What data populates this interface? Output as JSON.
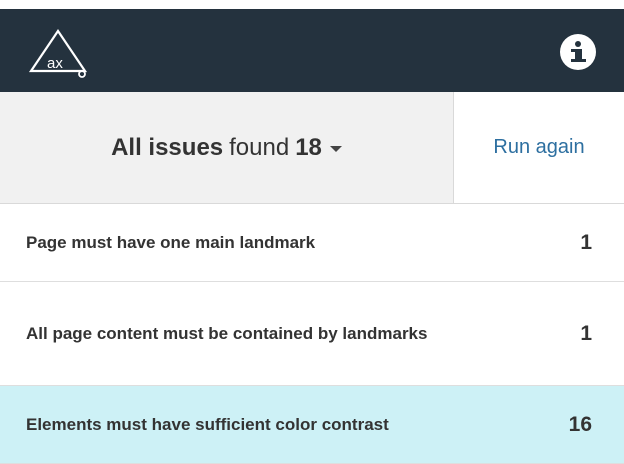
{
  "app": {
    "logo_text": "ax",
    "colors": {
      "header_bg": "#24323e",
      "toolbar_bg": "#f1f1f1",
      "link": "#2d6fa0",
      "selected_row": "#cdf1f6"
    },
    "icons": {
      "logo": "axe-logo-icon",
      "info": "info-icon",
      "dropdown": "chevron-down-icon"
    }
  },
  "toolbar": {
    "filter_bold": "All issues",
    "filter_text": "found",
    "filter_count": "18",
    "run_again_label": "Run again"
  },
  "issues": [
    {
      "label": "Page must have one main landmark",
      "count": "1",
      "selected": false
    },
    {
      "label": "All page content must be contained by landmarks",
      "count": "1",
      "selected": false
    },
    {
      "label": "Elements must have sufficient color contrast",
      "count": "16",
      "selected": true
    }
  ]
}
